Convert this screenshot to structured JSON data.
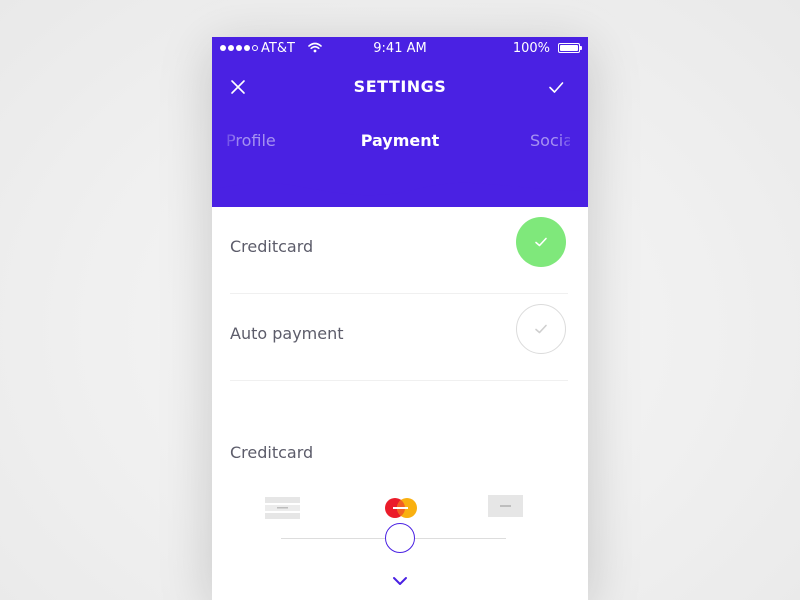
{
  "colors": {
    "primary": "#4a21e3",
    "toggle_on": "#7fe87b",
    "text": "#5c5c6a",
    "background": "#f1f1f1"
  },
  "status_bar": {
    "carrier": "AT&T",
    "time": "9:41 AM",
    "battery": "100%",
    "signal_icon": "signal-dots-icon",
    "wifi_icon": "wifi-icon",
    "battery_icon": "battery-full-icon"
  },
  "nav": {
    "title": "SETTINGS",
    "close_icon": "close-icon",
    "confirm_icon": "checkmark-icon"
  },
  "tabs": [
    {
      "label": "Profile",
      "active": false
    },
    {
      "label": "Payment",
      "active": true
    },
    {
      "label": "Social",
      "active": false
    }
  ],
  "settings": [
    {
      "label": "Creditcard",
      "enabled": true
    },
    {
      "label": "Auto payment",
      "enabled": false
    }
  ],
  "creditcard_section": {
    "label": "Creditcard",
    "card_types": [
      {
        "icon": "generic-card-icon",
        "selected": false
      },
      {
        "icon": "mastercard-icon",
        "selected": true
      },
      {
        "icon": "generic-card-alt-icon",
        "selected": false
      }
    ],
    "slider_position": 0.5,
    "expand_icon": "chevron-down-icon"
  }
}
